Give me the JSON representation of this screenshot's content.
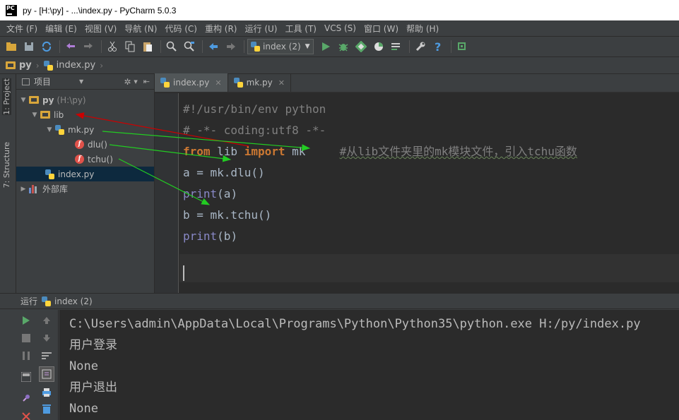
{
  "window": {
    "logo_text": "PC",
    "title": "py - [H:\\py] - ...\\index.py - PyCharm 5.0.3"
  },
  "menubar": {
    "items": [
      "文件 (F)",
      "编辑 (E)",
      "视图 (V)",
      "导航 (N)",
      "代码 (C)",
      "重构 (R)",
      "运行 (U)",
      "工具 (T)",
      "VCS (S)",
      "窗口 (W)",
      "帮助 (H)"
    ]
  },
  "toolbar": {
    "run_config": "index (2)"
  },
  "breadcrumb": {
    "project": "py",
    "file": "index.py"
  },
  "left_strip": {
    "project_tab": "1: Project",
    "structure_tab": "7: Structure"
  },
  "project_panel": {
    "header": "项目",
    "root": "py",
    "root_path": "(H:\\py)",
    "lib": "lib",
    "mk_file": "mk.py",
    "fn_dlu": "dlu()",
    "fn_tchu": "tchu()",
    "index_file": "index.py",
    "ext_libs": "外部库"
  },
  "editor": {
    "tabs": [
      {
        "label": "index.py",
        "active": true
      },
      {
        "label": "mk.py",
        "active": false
      }
    ],
    "code": {
      "line1": "#!/usr/bin/env python",
      "line2": "# -*- coding:utf8 -*-",
      "line3_kw1": "from",
      "line3_mod": " lib ",
      "line3_kw2": "import",
      "line3_name": " mk     ",
      "line3_comment": "#从lib文件夹里的mk模块文件，引入tchu函数",
      "line4": "a = mk.dlu()",
      "line5_fn": "print",
      "line5_arg": "(a)",
      "line6": "b = mk.tchu()",
      "line7_fn": "print",
      "line7_arg": "(b)"
    }
  },
  "run_panel": {
    "label": "运行",
    "config": "index (2)",
    "output": [
      "C:\\Users\\admin\\AppData\\Local\\Programs\\Python\\Python35\\python.exe H:/py/index.py",
      "用户登录",
      "None",
      "用户退出",
      "None"
    ]
  },
  "colors": {
    "annotation_red": "#cc0000",
    "annotation_green": "#22cc22",
    "keyword": "#cc7832",
    "comment": "#808080"
  }
}
